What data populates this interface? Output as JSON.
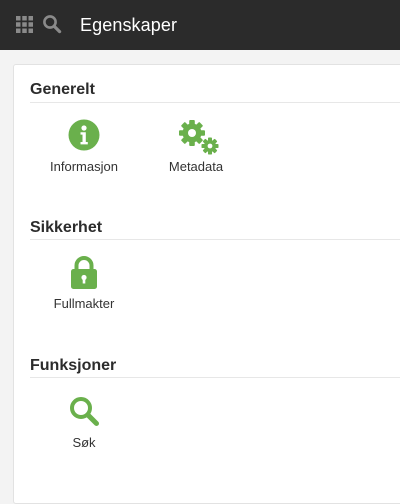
{
  "header": {
    "title": "Egenskaper",
    "apps_icon": "grid-icon",
    "search_icon": "search-icon",
    "background": "#2b2b2b"
  },
  "sections": [
    {
      "title": "Generelt",
      "items": [
        {
          "label": "Informasjon",
          "icon": "info-icon"
        },
        {
          "label": "Metadata",
          "icon": "gears-icon"
        }
      ]
    },
    {
      "title": "Sikkerhet",
      "items": [
        {
          "label": "Fullmakter",
          "icon": "lock-icon"
        }
      ]
    },
    {
      "title": "Funksjoner",
      "items": [
        {
          "label": "Søk",
          "icon": "search-icon"
        }
      ]
    }
  ],
  "accent_color": "#6ab04c"
}
